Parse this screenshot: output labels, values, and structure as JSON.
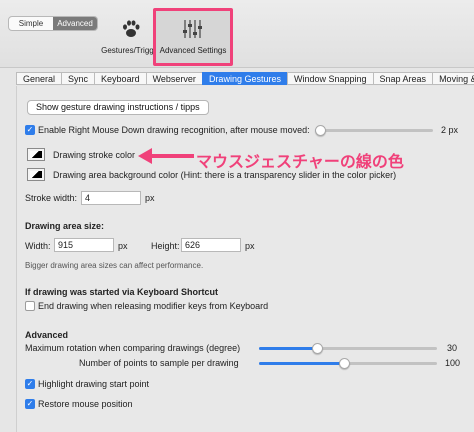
{
  "toolbar": {
    "mode_simple": "Simple",
    "mode_advanced": "Advanced",
    "gestures_label": "Gestures/Trigger",
    "advanced_label": "Advanced Settings"
  },
  "tabs": [
    "General",
    "Sync",
    "Keyboard",
    "Webserver",
    "Drawing Gestures",
    "Window Snapping",
    "Snap Areas",
    "Moving &"
  ],
  "selected_tab": "Drawing Gestures",
  "panel": {
    "show_instructions_button": "Show gesture drawing instructions / tipps",
    "enable_right_mouse": "Enable Right Mouse Down drawing recognition, after mouse moved:",
    "enable_right_mouse_checked": true,
    "move_threshold_value": "2 px",
    "move_threshold_fraction": 0.05,
    "stroke_color_label": "Drawing stroke color",
    "background_color_label": "Drawing area background color (Hint: there is a transparency slider in the color picker)",
    "stroke_width_label": "Stroke width:",
    "stroke_width_value": "4",
    "stroke_width_unit": "px",
    "area_size_heading": "Drawing area size:",
    "width_label": "Width:",
    "width_value": "915",
    "width_unit": "px",
    "height_label": "Height:",
    "height_value": "626",
    "height_unit": "px",
    "area_size_note": "Bigger drawing area sizes can affect performance.",
    "keyboard_shortcut_heading": "If drawing was started via Keyboard Shortcut",
    "end_drawing_label": "End drawing when releasing modifier keys from Keyboard",
    "end_drawing_checked": false,
    "advanced_heading": "Advanced",
    "max_rotation_label": "Maximum rotation when comparing drawings (degree)",
    "max_rotation_value": "30",
    "max_rotation_fraction": 0.33,
    "sample_points_label": "Number of points to sample per drawing",
    "sample_points_value": "100",
    "sample_points_fraction": 0.48,
    "highlight_start_label": "Highlight drawing start point",
    "highlight_start_checked": true,
    "restore_mouse_label": "Restore mouse position",
    "restore_mouse_checked": true
  },
  "annotation": {
    "text": "マウスジェスチャーの線の色",
    "color": "#f0417a"
  },
  "colors": {
    "accent": "#2f7dea",
    "highlight": "#f0417a"
  }
}
